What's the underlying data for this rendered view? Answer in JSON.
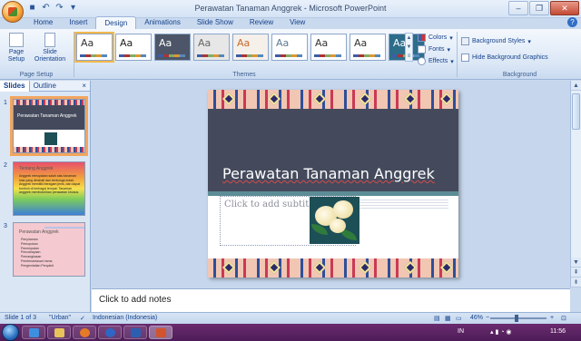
{
  "window": {
    "title": "Perawatan Tanaman Anggrek - Microsoft PowerPoint",
    "controls": [
      "–",
      "❐",
      "✕"
    ]
  },
  "quick_access": [
    "save-icon",
    "undo-icon",
    "redo-icon",
    "customize-icon"
  ],
  "tabs": [
    {
      "label": "Home"
    },
    {
      "label": "Insert"
    },
    {
      "label": "Design",
      "active": true
    },
    {
      "label": "Animations"
    },
    {
      "label": "Slide Show"
    },
    {
      "label": "Review"
    },
    {
      "label": "View"
    }
  ],
  "ribbon": {
    "page_setup": {
      "page_setup_label": "Page Setup",
      "slide_orientation_label": "Slide Orientation",
      "group_label": "Page Setup"
    },
    "themes": {
      "group_label": "Themes",
      "thumb_text": "Aa",
      "thumbs": [
        {
          "bg": "#ffffff",
          "fg": "#333333"
        },
        {
          "bg": "#ffffff",
          "fg": "#222222"
        },
        {
          "bg": "#4d5668",
          "fg": "#ffffff"
        },
        {
          "bg": "#e7e7e7",
          "fg": "#666666"
        },
        {
          "bg": "#f5f0ea",
          "fg": "#c86a2c"
        },
        {
          "bg": "#ffffff",
          "fg": "#5d7b93"
        },
        {
          "bg": "#ffffff",
          "fg": "#333333"
        },
        {
          "bg": "#ffffff",
          "fg": "#333333"
        },
        {
          "bg": "#2d6d8a",
          "fg": "#ffffff"
        }
      ],
      "selected_index": 0
    },
    "colors_label": "Colors",
    "fonts_label": "Fonts",
    "effects_label": "Effects",
    "background": {
      "group_label": "Background",
      "background_styles_label": "Background Styles",
      "hide_graphics_label": "Hide Background Graphics"
    }
  },
  "slides_pane": {
    "slides_tab": "Slides",
    "outline_tab": "Outline",
    "close": "×",
    "slides": [
      {
        "number": "1",
        "title": "Perawatan Tanaman Anggrek"
      },
      {
        "number": "2",
        "title": "Tentang Anggrek",
        "body": "Anggrek merupakan salah satu tanaman hias yang diminati dan berbunga indah. Anggrek memiliki beragam jenis, dan dapat tumbuh di berbagai tempat. Tanaman anggrek membutuhkan perawatan khusus."
      },
      {
        "number": "3",
        "title": "Perawatan Anggrek",
        "bullets": [
          "Penyiraman",
          "Pemupukan",
          "Penempatan",
          "Pencahayaan",
          "Pemangkasan",
          "Pemberantasan hama",
          "Pengendalian Penyakit"
        ]
      }
    ]
  },
  "slide": {
    "title": "Perawatan Tanaman Anggrek",
    "subtitle_placeholder": "Click to add subtitle"
  },
  "notes_placeholder": "Click to add notes",
  "status": {
    "slide_info": "Slide 1 of 3",
    "theme": "\"Urban\"",
    "language": "Indonesian (Indonesia)",
    "zoom": "46%",
    "zoom_fraction": 0.46
  },
  "taskbar": {
    "language": "IN",
    "time": "11:56"
  }
}
